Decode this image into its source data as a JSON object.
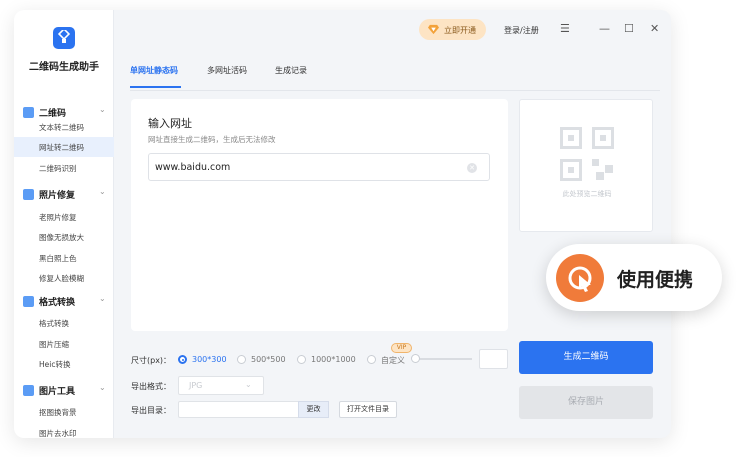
{
  "app": {
    "name": "二维码生成助手"
  },
  "topbar": {
    "vip_label": "立即开通",
    "login_label": "登录/注册",
    "menu_icon": "menu-icon",
    "minimize": "—",
    "maximize": "☐",
    "close": "✕"
  },
  "sidebar": {
    "groups": [
      {
        "label": "二维码",
        "icon": "qrcode-icon",
        "items": [
          "文本转二维码",
          "网址转二维码",
          "二维码识别"
        ]
      },
      {
        "label": "照片修复",
        "icon": "photo-repair-icon",
        "items": [
          "老照片修复",
          "图像无损放大",
          "黑白照上色",
          "修复人脸模糊"
        ]
      },
      {
        "label": "格式转换",
        "icon": "format-convert-icon",
        "items": [
          "格式转换",
          "图片压缩",
          "Heic转换"
        ]
      },
      {
        "label": "图片工具",
        "icon": "image-tools-icon",
        "items": [
          "抠图换背景",
          "图片去水印"
        ]
      }
    ],
    "active_item": "网址转二维码"
  },
  "tabs": [
    "单网址静态码",
    "多网址活码",
    "生成记录"
  ],
  "input_card": {
    "title": "输入网址",
    "hint": "网址直接生成二维码，生成后无法修改",
    "url_value": "www.baidu.com"
  },
  "preview": {
    "text": "此处预览二维码"
  },
  "size": {
    "label": "尺寸(px)：",
    "options": [
      "300*300",
      "500*500",
      "1000*1000",
      "自定义"
    ],
    "selected": "300*300",
    "vip_tag": "VIP"
  },
  "format": {
    "label": "导出格式：",
    "value": "JPG"
  },
  "export_dir": {
    "label": "导出目录：",
    "change_label": "更改",
    "open_label": "打开文件目录"
  },
  "buttons": {
    "generate": "生成二维码",
    "save": "保存图片"
  },
  "promo": {
    "text": "使用便携"
  },
  "colors": {
    "accent": "#2b73f0",
    "promo": "#f07b3a",
    "vip": "#fde4c4"
  }
}
